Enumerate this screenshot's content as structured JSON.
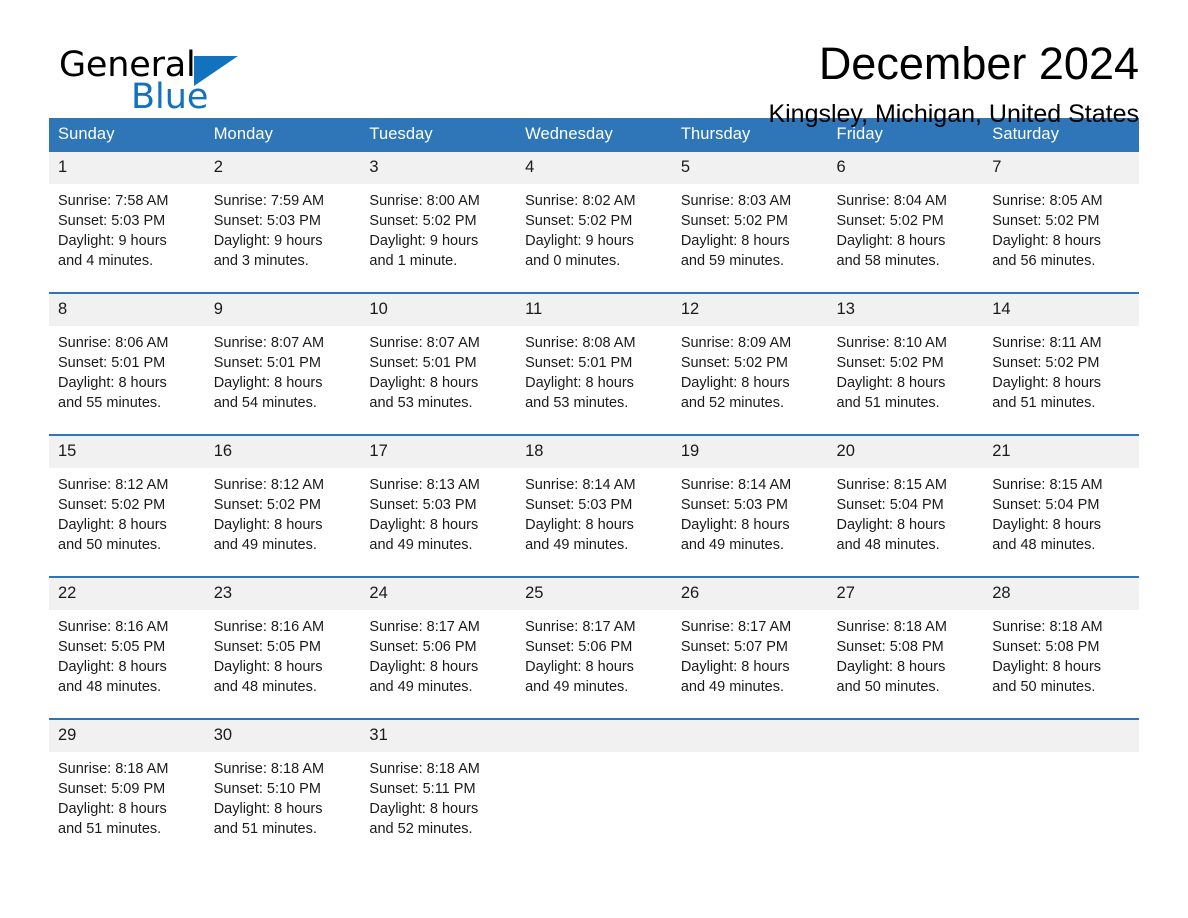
{
  "brand": {
    "name_part1": "General",
    "name_part2": "Blue",
    "logo_icon": "blue-triangle-icon",
    "accent_color": "#1272bd"
  },
  "header": {
    "title": "December 2024",
    "location": "Kingsley, Michigan, United States"
  },
  "theme": {
    "header_blue": "#2e76b8",
    "daynum_band": "#f1f1f1",
    "text": "#1a1a1a"
  },
  "calendar": {
    "weekday_headers": [
      "Sunday",
      "Monday",
      "Tuesday",
      "Wednesday",
      "Thursday",
      "Friday",
      "Saturday"
    ],
    "weeks": [
      [
        {
          "day": "1",
          "sunrise": "Sunrise: 7:58 AM",
          "sunset": "Sunset: 5:03 PM",
          "daylight": "Daylight: 9 hours and 4 minutes."
        },
        {
          "day": "2",
          "sunrise": "Sunrise: 7:59 AM",
          "sunset": "Sunset: 5:03 PM",
          "daylight": "Daylight: 9 hours and 3 minutes."
        },
        {
          "day": "3",
          "sunrise": "Sunrise: 8:00 AM",
          "sunset": "Sunset: 5:02 PM",
          "daylight": "Daylight: 9 hours and 1 minute."
        },
        {
          "day": "4",
          "sunrise": "Sunrise: 8:02 AM",
          "sunset": "Sunset: 5:02 PM",
          "daylight": "Daylight: 9 hours and 0 minutes."
        },
        {
          "day": "5",
          "sunrise": "Sunrise: 8:03 AM",
          "sunset": "Sunset: 5:02 PM",
          "daylight": "Daylight: 8 hours and 59 minutes."
        },
        {
          "day": "6",
          "sunrise": "Sunrise: 8:04 AM",
          "sunset": "Sunset: 5:02 PM",
          "daylight": "Daylight: 8 hours and 58 minutes."
        },
        {
          "day": "7",
          "sunrise": "Sunrise: 8:05 AM",
          "sunset": "Sunset: 5:02 PM",
          "daylight": "Daylight: 8 hours and 56 minutes."
        }
      ],
      [
        {
          "day": "8",
          "sunrise": "Sunrise: 8:06 AM",
          "sunset": "Sunset: 5:01 PM",
          "daylight": "Daylight: 8 hours and 55 minutes."
        },
        {
          "day": "9",
          "sunrise": "Sunrise: 8:07 AM",
          "sunset": "Sunset: 5:01 PM",
          "daylight": "Daylight: 8 hours and 54 minutes."
        },
        {
          "day": "10",
          "sunrise": "Sunrise: 8:07 AM",
          "sunset": "Sunset: 5:01 PM",
          "daylight": "Daylight: 8 hours and 53 minutes."
        },
        {
          "day": "11",
          "sunrise": "Sunrise: 8:08 AM",
          "sunset": "Sunset: 5:01 PM",
          "daylight": "Daylight: 8 hours and 53 minutes."
        },
        {
          "day": "12",
          "sunrise": "Sunrise: 8:09 AM",
          "sunset": "Sunset: 5:02 PM",
          "daylight": "Daylight: 8 hours and 52 minutes."
        },
        {
          "day": "13",
          "sunrise": "Sunrise: 8:10 AM",
          "sunset": "Sunset: 5:02 PM",
          "daylight": "Daylight: 8 hours and 51 minutes."
        },
        {
          "day": "14",
          "sunrise": "Sunrise: 8:11 AM",
          "sunset": "Sunset: 5:02 PM",
          "daylight": "Daylight: 8 hours and 51 minutes."
        }
      ],
      [
        {
          "day": "15",
          "sunrise": "Sunrise: 8:12 AM",
          "sunset": "Sunset: 5:02 PM",
          "daylight": "Daylight: 8 hours and 50 minutes."
        },
        {
          "day": "16",
          "sunrise": "Sunrise: 8:12 AM",
          "sunset": "Sunset: 5:02 PM",
          "daylight": "Daylight: 8 hours and 49 minutes."
        },
        {
          "day": "17",
          "sunrise": "Sunrise: 8:13 AM",
          "sunset": "Sunset: 5:03 PM",
          "daylight": "Daylight: 8 hours and 49 minutes."
        },
        {
          "day": "18",
          "sunrise": "Sunrise: 8:14 AM",
          "sunset": "Sunset: 5:03 PM",
          "daylight": "Daylight: 8 hours and 49 minutes."
        },
        {
          "day": "19",
          "sunrise": "Sunrise: 8:14 AM",
          "sunset": "Sunset: 5:03 PM",
          "daylight": "Daylight: 8 hours and 49 minutes."
        },
        {
          "day": "20",
          "sunrise": "Sunrise: 8:15 AM",
          "sunset": "Sunset: 5:04 PM",
          "daylight": "Daylight: 8 hours and 48 minutes."
        },
        {
          "day": "21",
          "sunrise": "Sunrise: 8:15 AM",
          "sunset": "Sunset: 5:04 PM",
          "daylight": "Daylight: 8 hours and 48 minutes."
        }
      ],
      [
        {
          "day": "22",
          "sunrise": "Sunrise: 8:16 AM",
          "sunset": "Sunset: 5:05 PM",
          "daylight": "Daylight: 8 hours and 48 minutes."
        },
        {
          "day": "23",
          "sunrise": "Sunrise: 8:16 AM",
          "sunset": "Sunset: 5:05 PM",
          "daylight": "Daylight: 8 hours and 48 minutes."
        },
        {
          "day": "24",
          "sunrise": "Sunrise: 8:17 AM",
          "sunset": "Sunset: 5:06 PM",
          "daylight": "Daylight: 8 hours and 49 minutes."
        },
        {
          "day": "25",
          "sunrise": "Sunrise: 8:17 AM",
          "sunset": "Sunset: 5:06 PM",
          "daylight": "Daylight: 8 hours and 49 minutes."
        },
        {
          "day": "26",
          "sunrise": "Sunrise: 8:17 AM",
          "sunset": "Sunset: 5:07 PM",
          "daylight": "Daylight: 8 hours and 49 minutes."
        },
        {
          "day": "27",
          "sunrise": "Sunrise: 8:18 AM",
          "sunset": "Sunset: 5:08 PM",
          "daylight": "Daylight: 8 hours and 50 minutes."
        },
        {
          "day": "28",
          "sunrise": "Sunrise: 8:18 AM",
          "sunset": "Sunset: 5:08 PM",
          "daylight": "Daylight: 8 hours and 50 minutes."
        }
      ],
      [
        {
          "day": "29",
          "sunrise": "Sunrise: 8:18 AM",
          "sunset": "Sunset: 5:09 PM",
          "daylight": "Daylight: 8 hours and 51 minutes."
        },
        {
          "day": "30",
          "sunrise": "Sunrise: 8:18 AM",
          "sunset": "Sunset: 5:10 PM",
          "daylight": "Daylight: 8 hours and 51 minutes."
        },
        {
          "day": "31",
          "sunrise": "Sunrise: 8:18 AM",
          "sunset": "Sunset: 5:11 PM",
          "daylight": "Daylight: 8 hours and 52 minutes."
        },
        {
          "day": "",
          "sunrise": "",
          "sunset": "",
          "daylight": ""
        },
        {
          "day": "",
          "sunrise": "",
          "sunset": "",
          "daylight": ""
        },
        {
          "day": "",
          "sunrise": "",
          "sunset": "",
          "daylight": ""
        },
        {
          "day": "",
          "sunrise": "",
          "sunset": "",
          "daylight": ""
        }
      ]
    ]
  }
}
